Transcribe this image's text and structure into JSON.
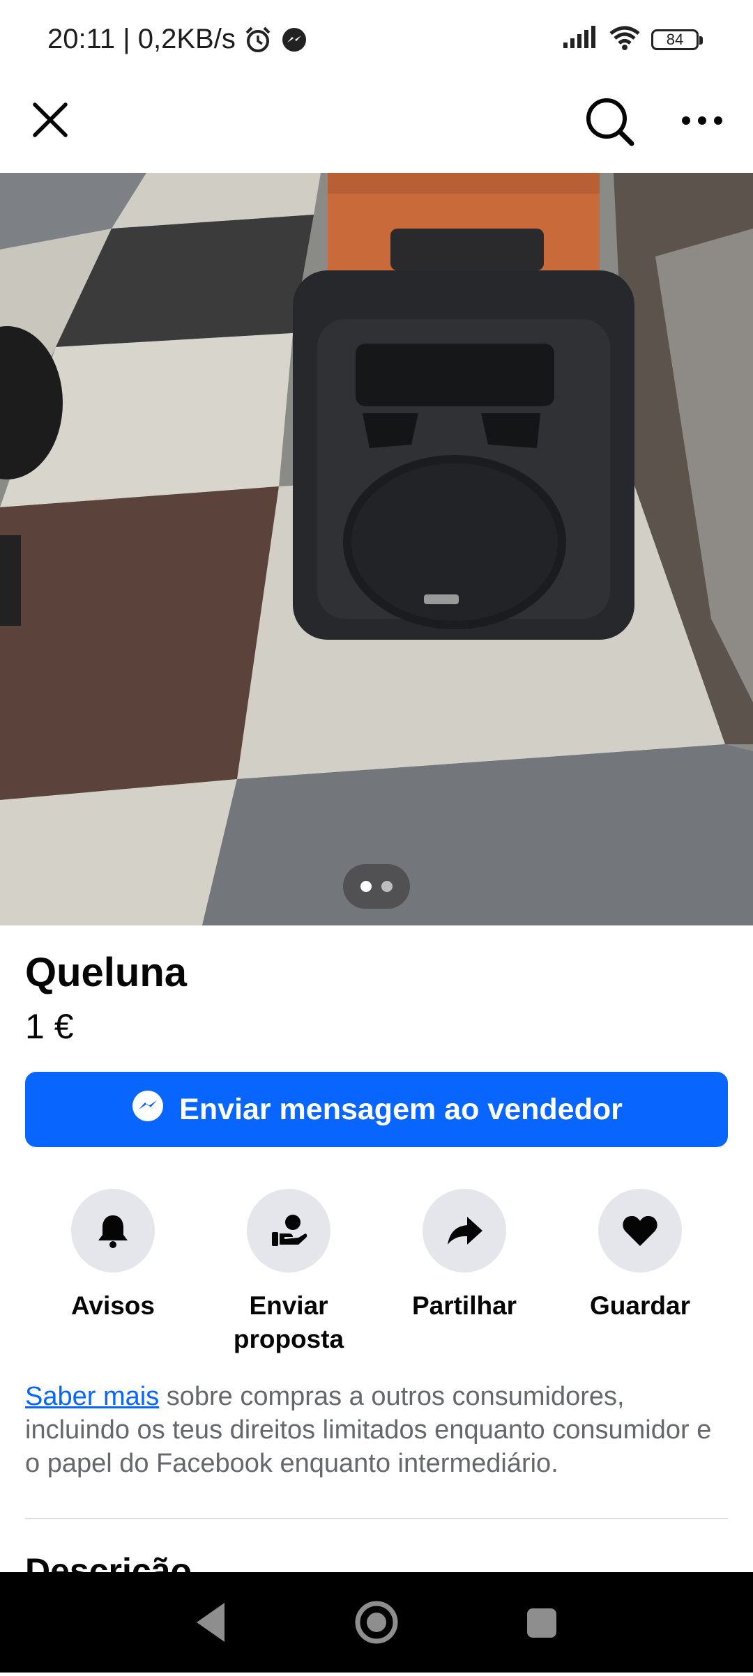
{
  "status_bar": {
    "time_speed": "20:11 | 0,2KB/s",
    "battery": "84",
    "icons": [
      "alarm-icon",
      "messenger-icon",
      "signal-icon",
      "wifi-icon",
      "battery-icon"
    ]
  },
  "top_bar": {
    "icons": [
      "close-icon",
      "search-icon",
      "more-icon"
    ]
  },
  "photo": {
    "subject": "speaker",
    "gallery_count": 2,
    "active_index": 1
  },
  "listing": {
    "title": "Queluna",
    "price": "1 €"
  },
  "message_button": {
    "label": "Enviar mensagem ao vendedor",
    "icon": "messenger-icon"
  },
  "actions": [
    {
      "label": "Avisos",
      "icon": "bell-icon"
    },
    {
      "label": "Enviar proposta",
      "icon": "offer-icon"
    },
    {
      "label": "Partilhar",
      "icon": "share-icon"
    },
    {
      "label": "Guardar",
      "icon": "heart-icon"
    }
  ],
  "info": {
    "link_text": "Saber mais",
    "text": " sobre compras a outros consumidores, incluindo os teus direitos limitados enquanto consumidor e o papel do Facebook enquanto intermediário."
  },
  "description_heading": "Descrição",
  "colors": {
    "accent": "#0866ff",
    "circle_bg": "#e4e6eb",
    "secondary_text": "#65676b"
  },
  "nav_bar": {
    "icons": [
      "back-icon",
      "home-icon",
      "recents-icon"
    ]
  }
}
